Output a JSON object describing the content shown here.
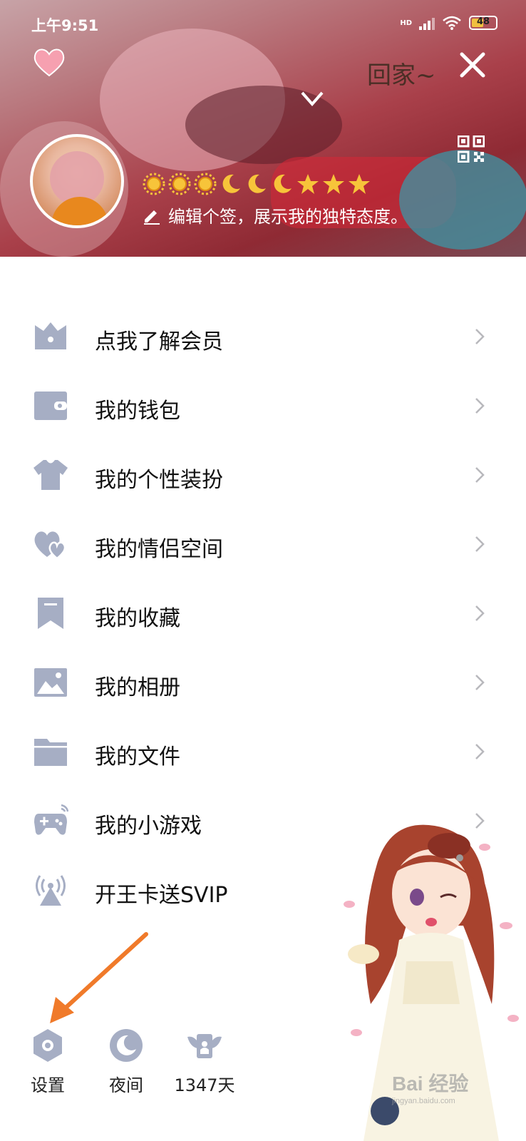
{
  "status_bar": {
    "time": "上午9:51",
    "network": "HD",
    "battery": "48"
  },
  "header": {
    "handwriting": "回家~",
    "signature": "编辑个签，展示我的独特态度。",
    "level_icons": [
      "sun",
      "sun",
      "sun",
      "moon",
      "moon",
      "moon",
      "star",
      "star",
      "star"
    ]
  },
  "menu": {
    "items": [
      {
        "label": "点我了解会员",
        "icon": "crown-icon"
      },
      {
        "label": "我的钱包",
        "icon": "wallet-icon"
      },
      {
        "label": "我的个性装扮",
        "icon": "shirt-icon"
      },
      {
        "label": "我的情侣空间",
        "icon": "hearts-icon"
      },
      {
        "label": "我的收藏",
        "icon": "bookmark-icon"
      },
      {
        "label": "我的相册",
        "icon": "photo-icon"
      },
      {
        "label": "我的文件",
        "icon": "folder-icon"
      },
      {
        "label": "我的小游戏",
        "icon": "gamepad-icon"
      },
      {
        "label": "开王卡送SVIP",
        "icon": "broadcast-icon"
      }
    ]
  },
  "bottom_bar": {
    "settings": "设置",
    "night": "夜间",
    "days": "1347天"
  },
  "watermark": {
    "brand": "Bai 经验",
    "url": "jingyan.baidu.com"
  },
  "colors": {
    "icon": "#a6aec4",
    "arrow": "#f07a2a",
    "text": "#111111"
  }
}
